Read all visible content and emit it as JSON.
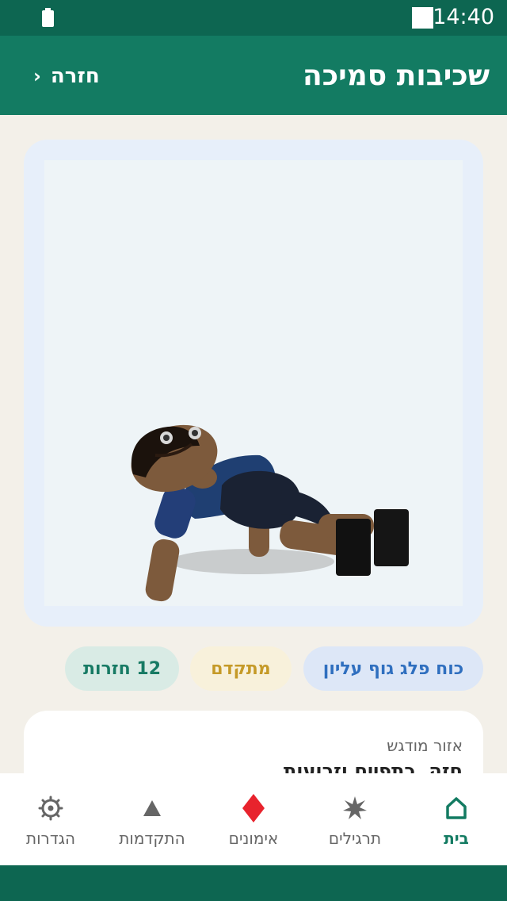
{
  "status": {
    "time": "14:40",
    "icons": [
      "battery-icon",
      "signal-square-icon"
    ]
  },
  "header": {
    "title": "שכיבות סמיכה",
    "back_label": "חזרה",
    "back_icon": "chevron-right-icon"
  },
  "exercise": {
    "illustration": "pushup-figure",
    "tags": {
      "muscle_group": "כוח פלג גוף עליון",
      "level": "מתקדם",
      "reps": "12 חזרות"
    },
    "focus": {
      "label": "אזור מודגש",
      "value": "חזה, כתפיים וזרועות"
    }
  },
  "nav": {
    "items": [
      {
        "label": "בית",
        "icon": "home-icon",
        "active": true
      },
      {
        "label": "תרגילים",
        "icon": "burst-icon",
        "active": false
      },
      {
        "label": "אימונים",
        "icon": "diamond-icon",
        "active": false
      },
      {
        "label": "התקדמות",
        "icon": "triangle-icon",
        "active": false
      },
      {
        "label": "הגדרות",
        "icon": "gear-icon",
        "active": false
      }
    ]
  },
  "colors": {
    "primary": "#137b62",
    "status_bar": "#0d6651",
    "background": "#f3f0e9",
    "diamond": "#e8232d"
  }
}
